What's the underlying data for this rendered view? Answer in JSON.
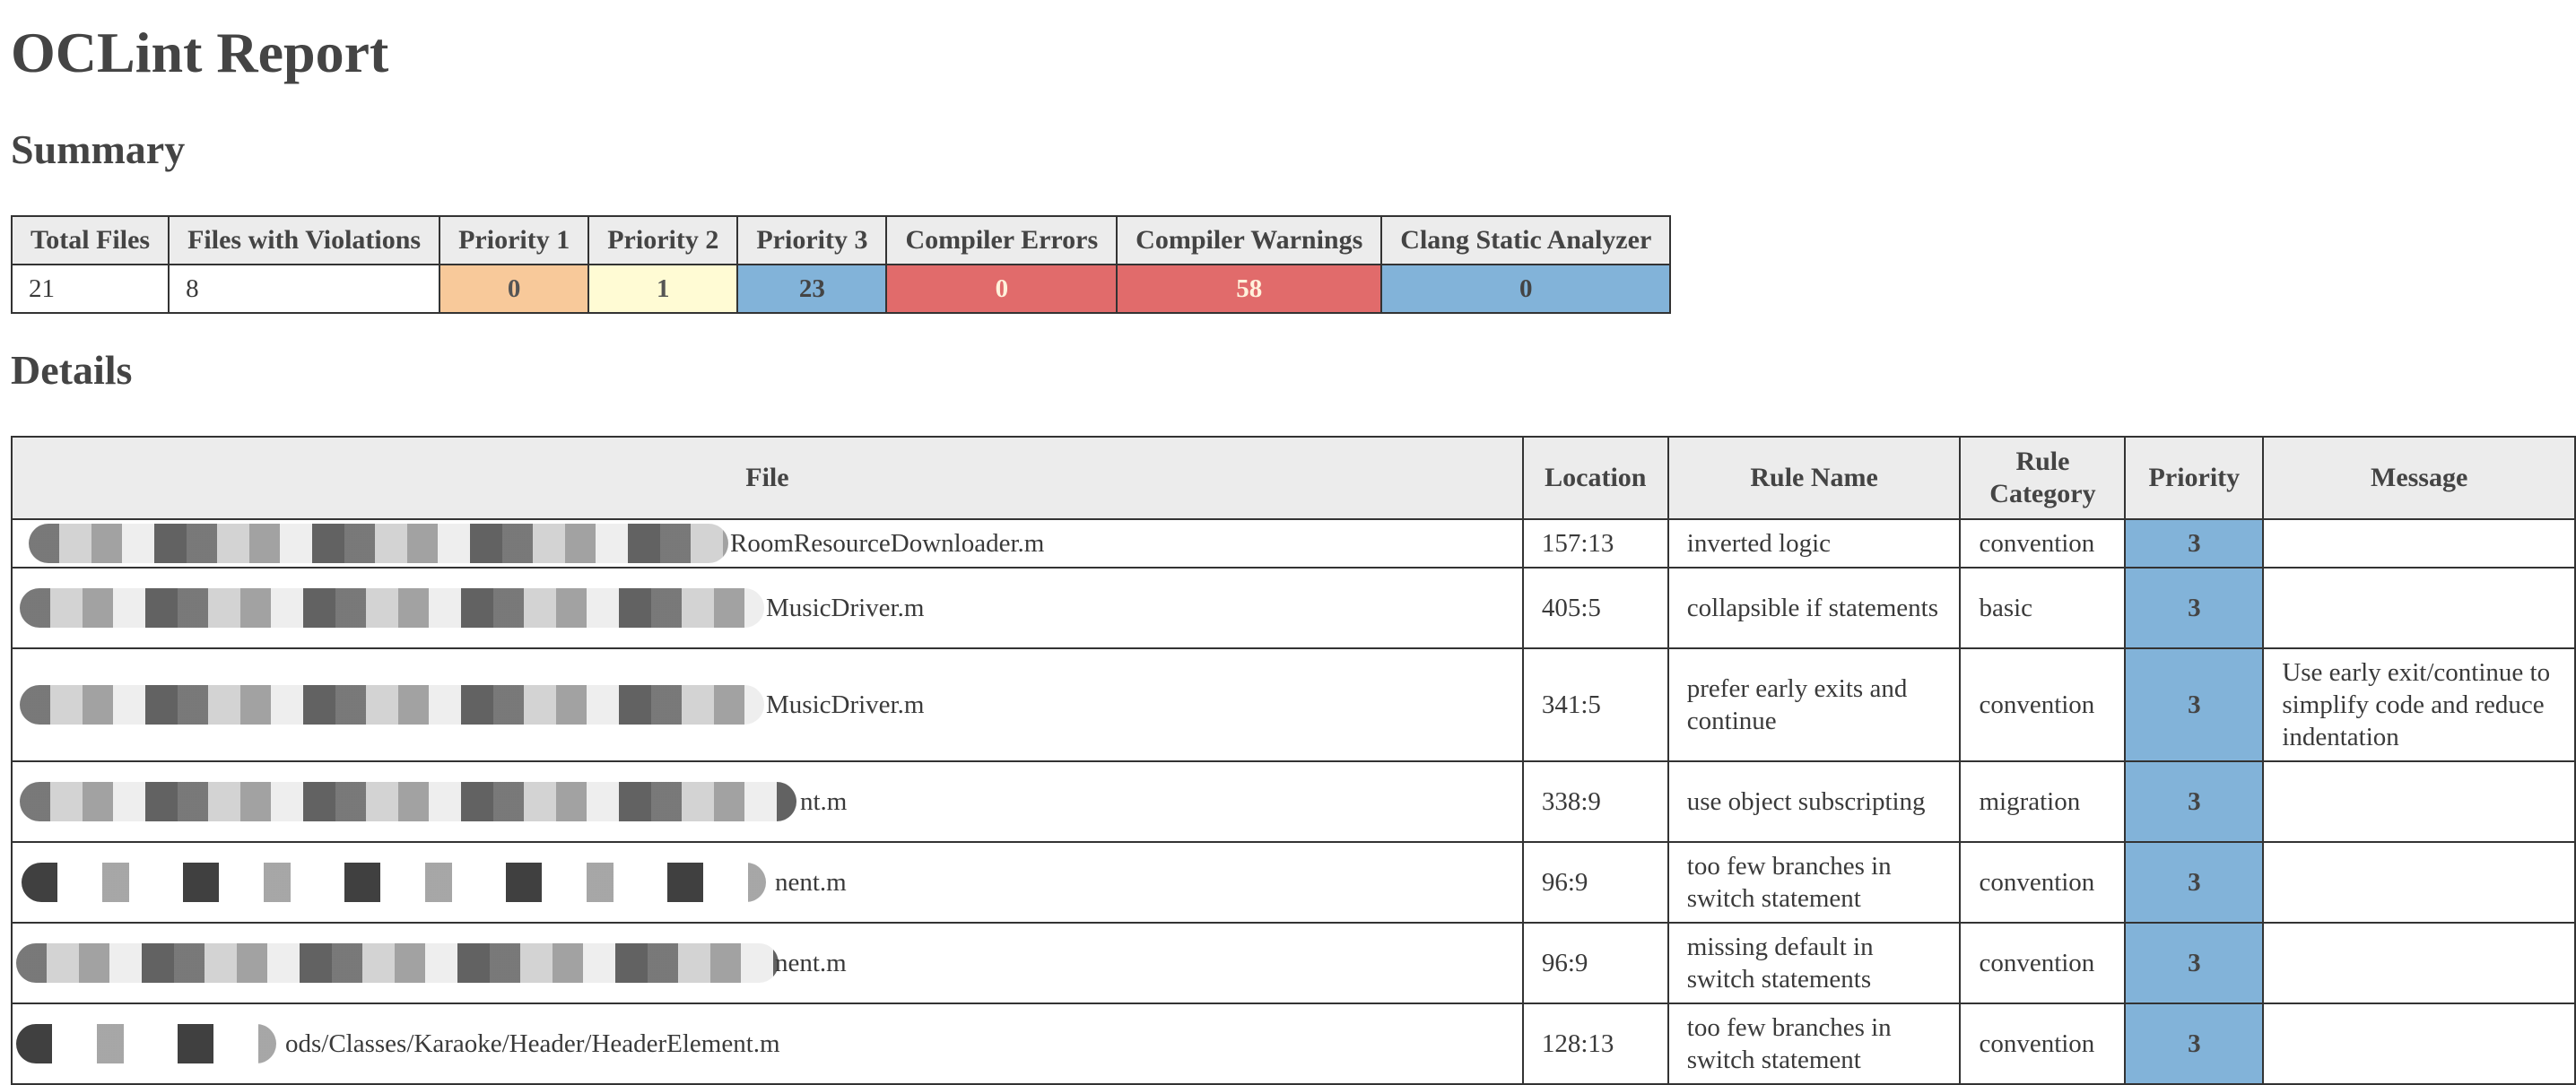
{
  "header": {
    "title": "OCLint Report"
  },
  "summary": {
    "title": "Summary",
    "headers": [
      "Total Files",
      "Files with Violations",
      "Priority 1",
      "Priority 2",
      "Priority 3",
      "Compiler Errors",
      "Compiler Warnings",
      "Clang Static Analyzer"
    ],
    "values": [
      "21",
      "8",
      "0",
      "1",
      "23",
      "0",
      "58",
      "0"
    ]
  },
  "details": {
    "title": "Details",
    "headers": [
      "File",
      "Location",
      "Rule Name",
      "Rule Category",
      "Priority",
      "Message"
    ],
    "rows": [
      {
        "file": "RoomResourceDownloader.m",
        "location": "157:13",
        "rule": "inverted logic",
        "category": "convention",
        "priority": "3",
        "message": ""
      },
      {
        "file": "MusicDriver.m",
        "location": "405:5",
        "rule": "collapsible if statements",
        "category": "basic",
        "priority": "3",
        "message": ""
      },
      {
        "file": "MusicDriver.m",
        "location": "341:5",
        "rule": "prefer early exits and continue",
        "category": "convention",
        "priority": "3",
        "message": "Use early exit/continue to simplify code and reduce indentation"
      },
      {
        "file": "nt.m",
        "location": "338:9",
        "rule": "use object subscripting",
        "category": "migration",
        "priority": "3",
        "message": ""
      },
      {
        "file": "nent.m",
        "location": "96:9",
        "rule": "too few branches in switch statement",
        "category": "convention",
        "priority": "3",
        "message": ""
      },
      {
        "file": "nent.m",
        "location": "96:9",
        "rule": "missing default in switch statements",
        "category": "convention",
        "priority": "3",
        "message": ""
      },
      {
        "file": "ods/Classes/Karaoke/Header/HeaderElement.m",
        "location": "128:13",
        "rule": "too few branches in switch statement",
        "category": "convention",
        "priority": "3",
        "message": ""
      }
    ]
  },
  "colors": {
    "priority1": "#f8c99a",
    "priority2": "#fffbd4",
    "priority3": "#82b3d9",
    "error": "#e16b6b",
    "header_bg": "#ececec"
  }
}
